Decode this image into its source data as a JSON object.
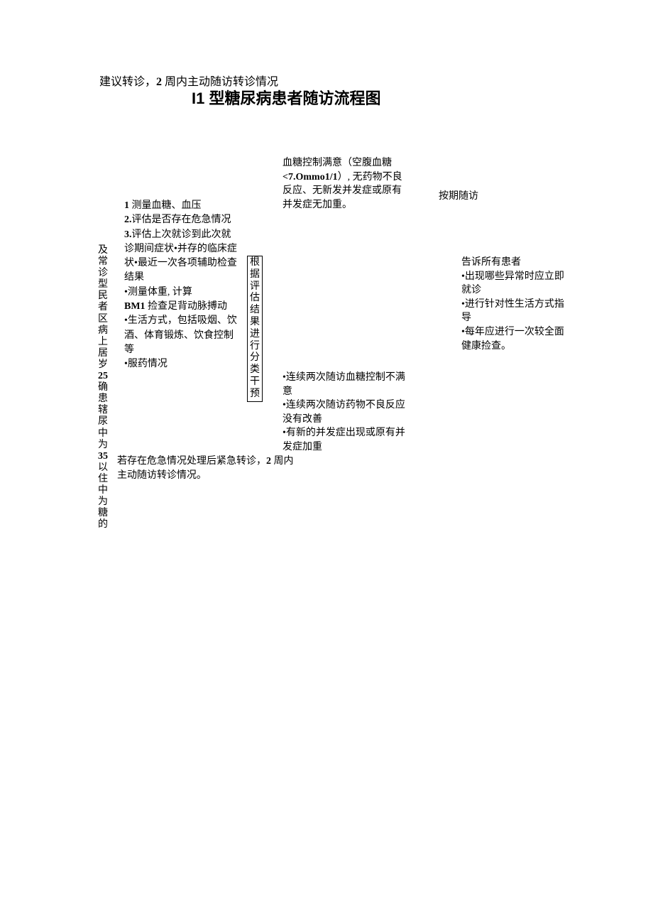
{
  "header_line_a": "建议转诊，",
  "header_line_b": "2 ",
  "header_line_c": "周内主动随访转诊情况",
  "title": "I1 型糖尿病患者随访流程图",
  "vbox_l1": "及常",
  "vbox_l2": "诊型",
  "vbox_l3": "民者区",
  "vbox_l4": "病上居",
  "vbox_l5a": "岁",
  "vbox_l5n": "25",
  "vbox_l6": "确患辖",
  "vbox_l7": "尿中为",
  "vbox_l8n": "35",
  "vbox_l8a": " 以",
  "vbox_l9": "住中为",
  "vbox_l10": "糖的",
  "exam_l1a": "1 ",
  "exam_l1b": "测量血糖、血压",
  "exam_l2a": "2.",
  "exam_l2b": "评估是否存在危急情况",
  "exam_l3a": "3.",
  "exam_l3b": "评估上次就诊到此次就诊期间症状•并存的临床症状•最近一次各项辅助检查结果",
  "exam_l4": "•测量体重, 计算",
  "exam_l5a": "BM1 ",
  "exam_l5b": "捡查足背动脉搏动",
  "exam_l6": "•生活方式，包括吸烟、饮酒、体育锻炼、饮食控制等",
  "exam_l7": "•服药情况",
  "classify": "根据评估结果进行分类干预",
  "sat_a": "血糖控制满意（空腹血糖",
  "sat_b": "<7.Ommo1/1",
  "sat_c": "）, 无药物不良反应、无新发并发症或原有并发症无加重。",
  "followup": "按期随访",
  "unsat_l1": "•连续两次随访血糖控制不满意",
  "unsat_l2": "•连续两次随访药物不良反应没有改善",
  "unsat_l3": "•有新的并发症出现或原有并发症加重",
  "advice_h": "告诉所有患者",
  "advice_l1": "•出现哪些异常时应立即就诊",
  "advice_l2": "•进行针对性生活方式指导",
  "advice_l3": "•每年应进行一次较全面健康捡查。",
  "emerg_a": "若存在危急情况处理后紧急转诊，",
  "emerg_b": "2 ",
  "emerg_c": "周内主动随访转诊情况。"
}
